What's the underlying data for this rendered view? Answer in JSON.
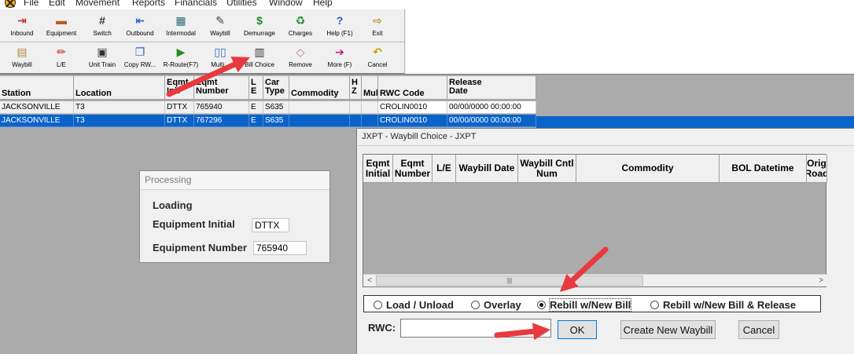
{
  "menu": [
    "File",
    "Edit",
    "Movement",
    "Reports",
    "Financials",
    "Utilities",
    "Window",
    "Help"
  ],
  "toolbar1": [
    {
      "label": "Inbound",
      "icon": "inbound-icon",
      "glyph": "⇥",
      "color": "#c03030"
    },
    {
      "label": "Equipment",
      "icon": "railcar-icon",
      "glyph": "▬",
      "color": "#c05a1c"
    },
    {
      "label": "Switch",
      "icon": "switch-icon",
      "glyph": "#",
      "color": "#333333"
    },
    {
      "label": "Outbound",
      "icon": "outbound-icon",
      "glyph": "⇤",
      "color": "#2a62c0"
    },
    {
      "label": "Intermodal",
      "icon": "intermodal-icon",
      "glyph": "▦",
      "color": "#2a6a70"
    },
    {
      "label": "Waybill",
      "icon": "waybill-icon",
      "glyph": "✎",
      "color": "#444444"
    },
    {
      "label": "Demurrage",
      "icon": "dollar-icon",
      "glyph": "$",
      "color": "#1f8a2b"
    },
    {
      "label": "Charges",
      "icon": "charges-icon",
      "glyph": "♻",
      "color": "#1f8a2b"
    },
    {
      "label": "Help (F1)",
      "icon": "help-icon",
      "glyph": "?",
      "color": "#2a62c0"
    },
    {
      "label": "Exit",
      "icon": "exit-icon",
      "glyph": "⇨",
      "color": "#c08a1c"
    }
  ],
  "toolbar2": [
    {
      "label": "Waybill",
      "icon": "waybill-doc-icon",
      "glyph": "▤",
      "color": "#b08a3c"
    },
    {
      "label": "L/E",
      "icon": "pencil-icon",
      "glyph": "✏",
      "color": "#c02020"
    },
    {
      "label": "Unit Train",
      "icon": "unit-train-icon",
      "glyph": "▣",
      "color": "#333333"
    },
    {
      "label": "Copy RW...",
      "icon": "copy-icon",
      "glyph": "❐",
      "color": "#2a62c0"
    },
    {
      "label": "R-Route(F7)",
      "icon": "reroute-icon",
      "glyph": "▶",
      "color": "#2a8a2a"
    },
    {
      "label": "Multi...",
      "icon": "multi-icon",
      "glyph": "▯▯",
      "color": "#2a62c0"
    },
    {
      "label": "Bill Choice",
      "icon": "bill-choice-icon",
      "glyph": "▥",
      "color": "#333333"
    },
    {
      "label": "Remove",
      "icon": "eraser-icon",
      "glyph": "◇",
      "color": "#b07a70"
    },
    {
      "label": "More (F)",
      "icon": "more-icon",
      "glyph": "➔",
      "color": "#c0207a"
    },
    {
      "label": "Cancel",
      "icon": "cancel-icon",
      "glyph": "↶",
      "color": "#c8a000"
    }
  ],
  "grid": {
    "columns": [
      "Station",
      "Location",
      "Eqmt Init",
      "Eqmt Number",
      "L E",
      "Car Type",
      "Commodity",
      "H Z",
      "Mul",
      "RWC Code",
      "Release Date"
    ],
    "rows": [
      [
        "JACKSONVILLE",
        "T3",
        "DTTX",
        "765940",
        "E",
        "S635",
        "",
        "",
        "",
        "CROLIN0010",
        "00/00/0000 00:00:00"
      ],
      [
        "JACKSONVILLE",
        "T3",
        "DTTX",
        "767296",
        "E",
        "S635",
        "",
        "",
        "",
        "CROLIN0010",
        "00/00/0000 00:00:00"
      ]
    ],
    "selected_row": 1
  },
  "processing": {
    "title": "Processing",
    "status": "Loading",
    "equipment_initial_label": "Equipment Initial",
    "equipment_initial_value": "DTTX",
    "equipment_number_label": "Equipment Number",
    "equipment_number_value": "765940"
  },
  "dialog": {
    "title": "JXPT - Waybill Choice - JXPT",
    "columns": [
      "Eqmt Initial",
      "Eqmt Number",
      "L/E",
      "Waybill Date",
      "Waybill Cntl Num",
      "Commodity",
      "BOL Datetime",
      "Orig Road"
    ],
    "options": [
      {
        "label": "Load / Unload",
        "selected": false
      },
      {
        "label": "Overlay",
        "selected": false
      },
      {
        "label": "Rebill w/New Bill",
        "selected": true
      },
      {
        "label": "Rebill w/New Bill & Release",
        "selected": false
      }
    ],
    "rwc_label": "RWC:",
    "rwc_value": "",
    "ok": "OK",
    "create_new": "Create New Waybill",
    "cancel": "Cancel"
  },
  "annotation_color": "#e8393f"
}
